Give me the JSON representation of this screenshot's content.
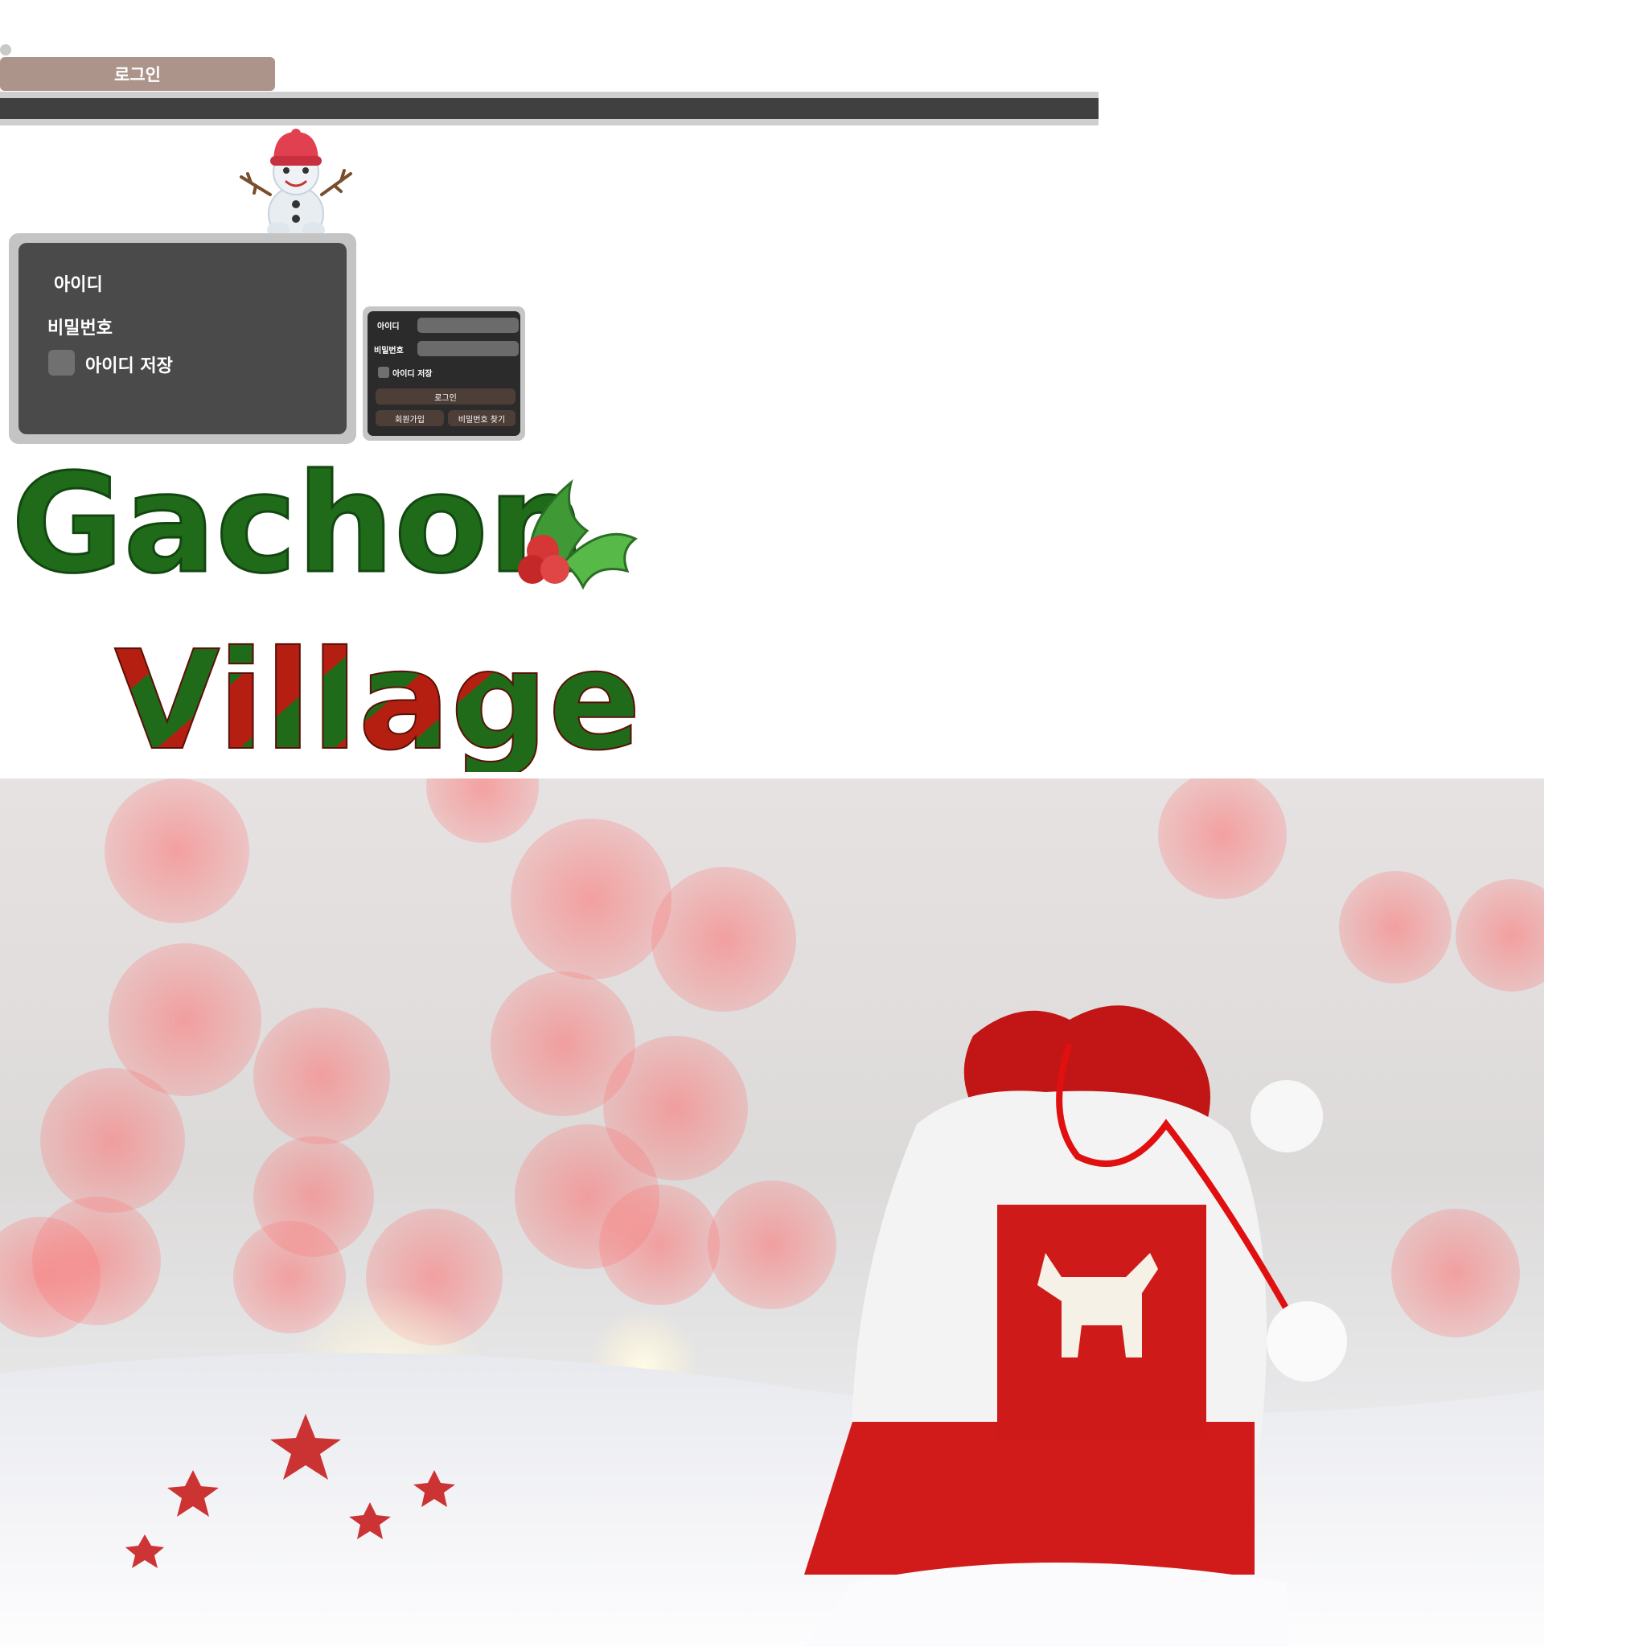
{
  "header": {
    "login_button": "로그인"
  },
  "login_panel": {
    "id_label": "아이디",
    "pw_label": "비밀번호",
    "save_id_label": "아이디 저장"
  },
  "login_card": {
    "id_label": "아이디",
    "pw_label": "비밀번호",
    "id_value": "",
    "pw_value": "",
    "save_id_label": "아이디 저장",
    "login_button": "로그인",
    "signup_button": "회원가입",
    "find_pw_button": "비밀번호 찾기"
  },
  "logo": {
    "line1": "Gachon",
    "line2": "Village"
  },
  "colors": {
    "accent_button": "#ac948b",
    "bar": "#404040",
    "panel_dark": "#4a4a4a",
    "logo_green": "#1f6b1a",
    "logo_red": "#b51f12"
  },
  "icons": {
    "mascot": "snowman-icon",
    "logo_deco": "holly-icon",
    "hero": "christmas-gift-bag-photo"
  }
}
